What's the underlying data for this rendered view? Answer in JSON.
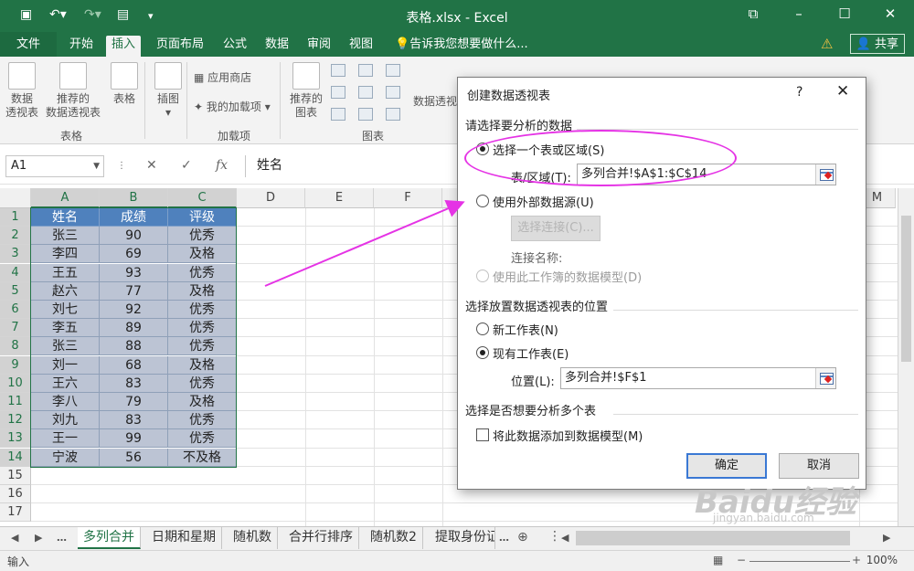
{
  "window": {
    "title": "表格.xlsx - Excel"
  },
  "tabs": [
    {
      "label": "文件"
    },
    {
      "label": "开始"
    },
    {
      "label": "插入"
    },
    {
      "label": "页面布局"
    },
    {
      "label": "公式"
    },
    {
      "label": "数据"
    },
    {
      "label": "审阅"
    },
    {
      "label": "视图"
    }
  ],
  "tell_me": "告诉我您想要做什么...",
  "share": "共享",
  "ribbon": {
    "pivot_line1": "数据",
    "pivot_line2": "透视表",
    "rec_pivot_line1": "推荐的",
    "rec_pivot_line2": "数据透视表",
    "table": "表格",
    "group_tables": "表格",
    "illustrations": "插图",
    "app_store": "应用商店",
    "my_addins": "我的加载项",
    "group_addins": "加载项",
    "rec_charts_line1": "推荐的",
    "rec_charts_line2": "图表",
    "group_charts": "图表",
    "pivot_chart": "数据透视"
  },
  "formula_bar": {
    "name_box": "A1",
    "formula": "姓名",
    "fx": "fx"
  },
  "columns": [
    "A",
    "B",
    "C",
    "D",
    "E",
    "F",
    "M"
  ],
  "rows": [
    "1",
    "2",
    "3",
    "4",
    "5",
    "6",
    "7",
    "8",
    "9",
    "10",
    "11",
    "12",
    "13",
    "14",
    "15",
    "16",
    "17"
  ],
  "table": {
    "headers": [
      "姓名",
      "成绩",
      "评级"
    ],
    "rows": [
      [
        "张三",
        "90",
        "优秀"
      ],
      [
        "李四",
        "69",
        "及格"
      ],
      [
        "王五",
        "93",
        "优秀"
      ],
      [
        "赵六",
        "77",
        "及格"
      ],
      [
        "刘七",
        "92",
        "优秀"
      ],
      [
        "李五",
        "89",
        "优秀"
      ],
      [
        "张三",
        "88",
        "优秀"
      ],
      [
        "刘一",
        "68",
        "及格"
      ],
      [
        "王六",
        "83",
        "优秀"
      ],
      [
        "李八",
        "79",
        "及格"
      ],
      [
        "刘九",
        "83",
        "优秀"
      ],
      [
        "王一",
        "99",
        "优秀"
      ],
      [
        "宁波",
        "56",
        "不及格"
      ]
    ]
  },
  "sheets": [
    "多列合并",
    "日期和星期",
    "随机数",
    "合并行排序",
    "随机数2",
    "提取身份证"
  ],
  "status": {
    "mode": "输入",
    "zoom": "100%"
  },
  "dialog": {
    "title": "创建数据透视表",
    "help": "?",
    "close": "✕",
    "section1": "请选择要分析的数据",
    "opt_range": "选择一个表或区域(S)",
    "range_label": "表/区域(T):",
    "range_value": "多列合并!$A$1:$C$14",
    "opt_external": "使用外部数据源(U)",
    "choose_conn": "选择连接(C)...",
    "conn_name": "连接名称:",
    "opt_model": "使用此工作簿的数据模型(D)",
    "section2": "选择放置数据透视表的位置",
    "opt_new": "新工作表(N)",
    "opt_existing": "现有工作表(E)",
    "loc_label": "位置(L):",
    "loc_value": "多列合并!$F$1",
    "section3": "选择是否想要分析多个表",
    "add_model": "将此数据添加到数据模型(M)",
    "ok": "确定",
    "cancel": "取消"
  },
  "watermark": {
    "brand": "Baidu经验",
    "url": "jingyan.baidu.com"
  }
}
